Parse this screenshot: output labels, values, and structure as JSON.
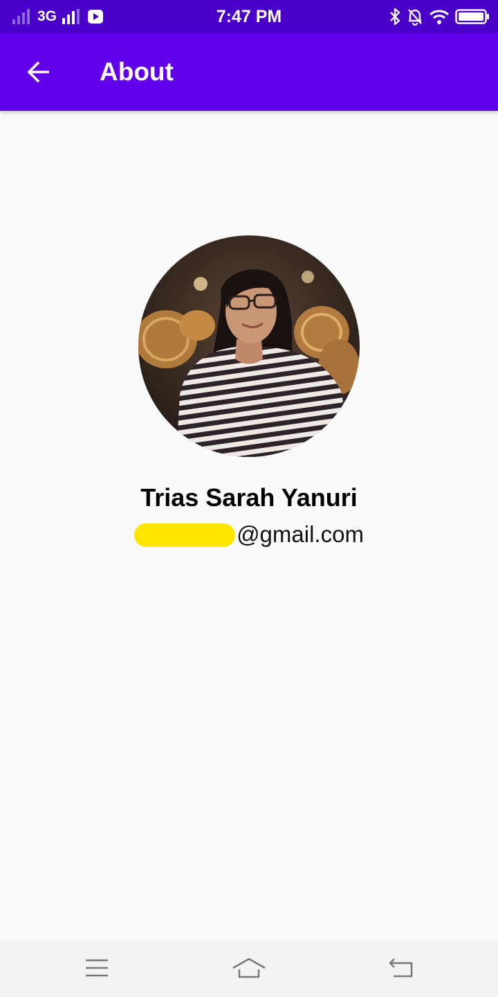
{
  "status_bar": {
    "time": "7:47 PM",
    "network": "3G",
    "icons": [
      "signal-icon",
      "signal-icon",
      "youtube-icon",
      "bluetooth-icon",
      "bell-off-icon",
      "wifi-icon",
      "battery-icon"
    ]
  },
  "app_bar": {
    "title": "About",
    "background": "#6200ea",
    "back_icon": "arrow-left-icon"
  },
  "profile": {
    "name": "Trias Sarah Yanuri",
    "email_suffix": "@gmail.com",
    "avatar": "profile-photo"
  },
  "nav_bar": {
    "icons": [
      "menu-icon",
      "home-icon",
      "back-icon"
    ]
  },
  "colors": {
    "status_bar": "#4a00c8",
    "accent": "#6200ea",
    "redaction": "#ffe600",
    "background": "#fafafa"
  }
}
